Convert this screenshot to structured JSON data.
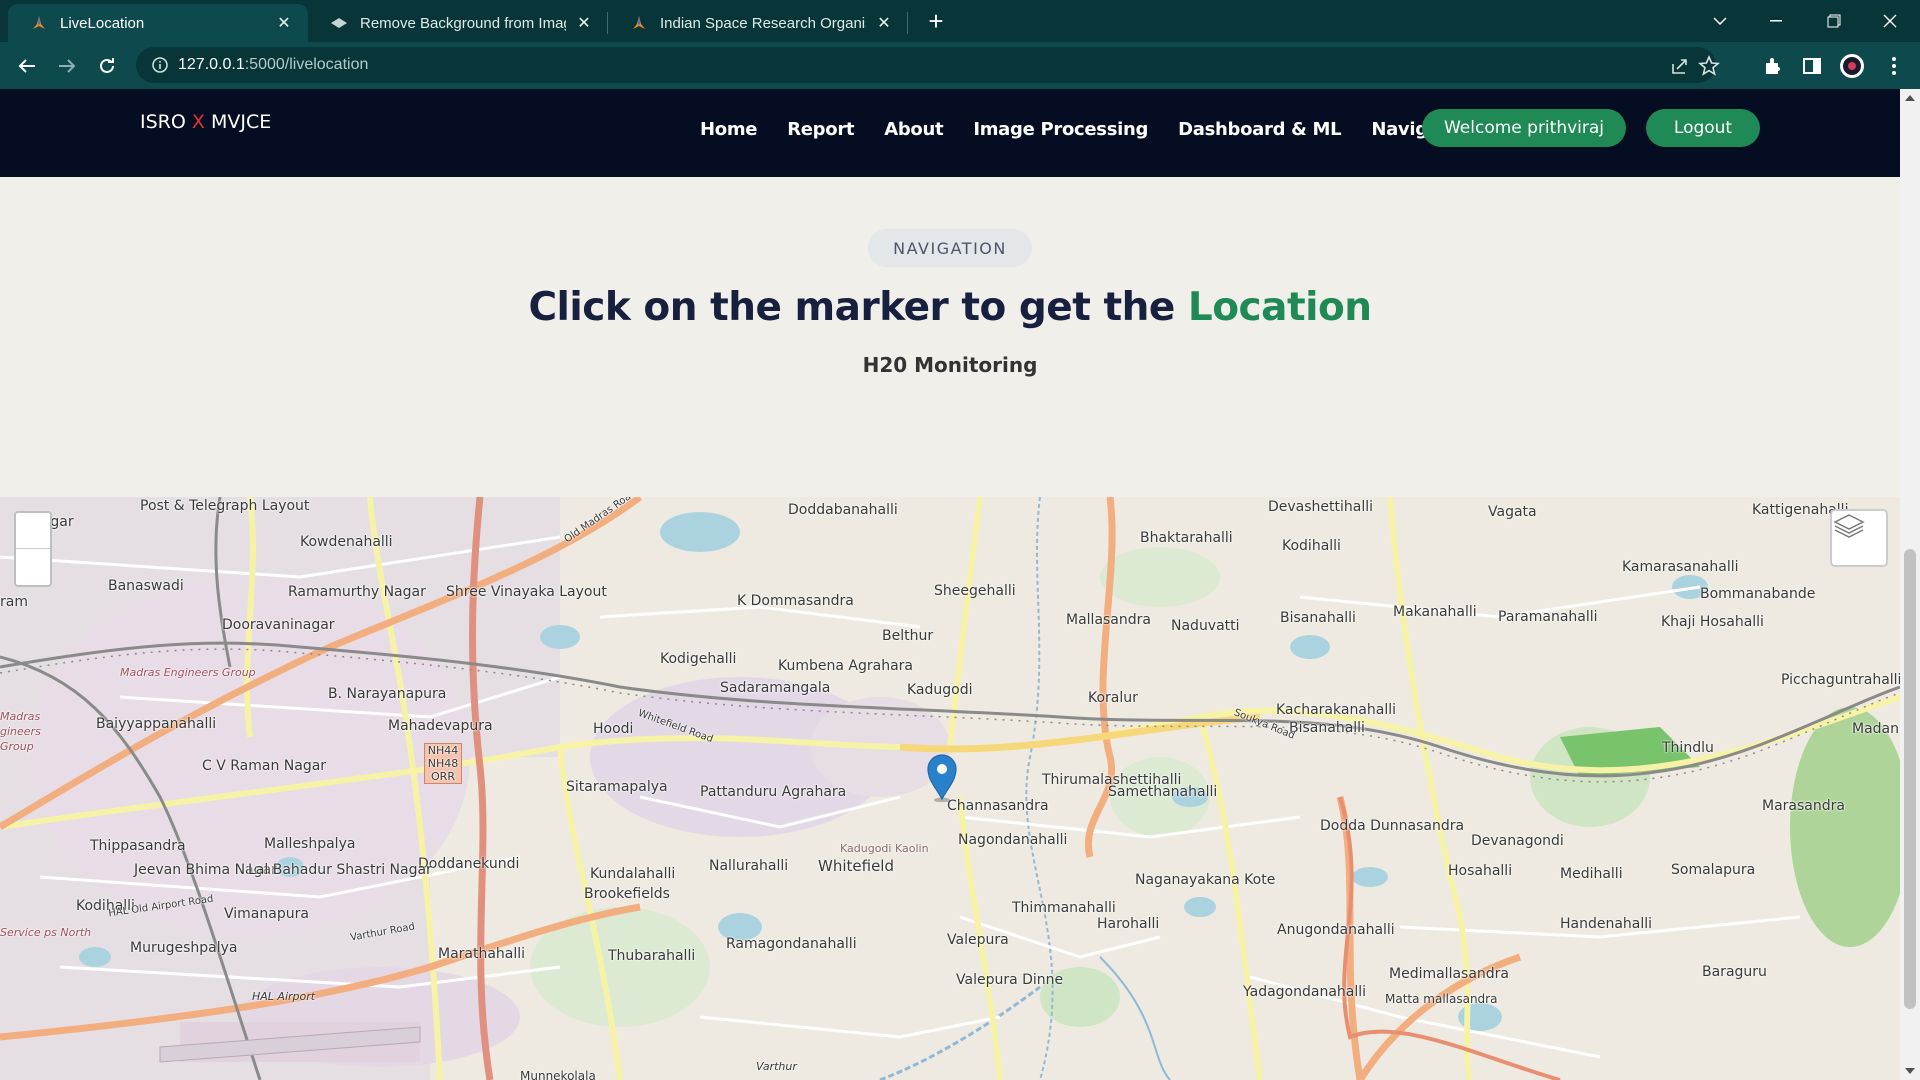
{
  "browser": {
    "tabs": [
      {
        "title": "LiveLocation",
        "active": true
      },
      {
        "title": "Remove Background from Image",
        "active": false
      },
      {
        "title": "Indian Space Research Organisati",
        "active": false
      }
    ],
    "url_host": "127.0.0.1",
    "url_path": ":5000/livelocation"
  },
  "navbar": {
    "brand_left": "ISRO ",
    "brand_x": "X",
    "brand_right": " MVJCE",
    "links": [
      "Home",
      "Report",
      "About",
      "Image Processing",
      "Dashboard & ML",
      "Navigation"
    ],
    "welcome": "Welcome prithviraj",
    "logout": "Logout"
  },
  "hero": {
    "tag": "NAVIGATION",
    "headline_plain": "Click on the marker to get the ",
    "headline_accent": "Location",
    "subhead": "H20 Monitoring"
  },
  "map": {
    "labels": [
      "Post & Telegraph Layout",
      "n Nagar",
      "Kowdenahalli",
      "Doddabanahalli",
      "Devashettihalli",
      "Vagata",
      "Kattigenahalli",
      "Bhaktarahalli",
      "Kodihalli",
      "Kamarasanahalli",
      "Bommanabande",
      "Banaswadi",
      "Ramamurthy Nagar",
      "Shree Vinayaka Layout",
      "K Dommasandra",
      "Sheegehalli",
      "ram",
      "Dooravaninagar",
      "Mallasandra",
      "Naduvatti",
      "Bisanahalli",
      "Makanahalli",
      "Paramanahalli",
      "Khaji Hosahalli",
      "Madras Engineers Group",
      "Belthur",
      "Kodigehalli",
      "Kumbena Agrahara",
      "B. Narayanapura",
      "Baiyyappanahalli",
      "Sadaramangala",
      "Kadugodi",
      "Koralur",
      "Kacharakanahalli",
      "Picchaguntrahalli",
      "Mahadevapura",
      "Hoodi",
      "Bisanahalli",
      "Madanah",
      "Thindlu",
      "C V Raman Nagar",
      "Sitaramapalya",
      "Thirumalashettihalli",
      "Samethanahalli",
      "Pattanduru Agrahara",
      "Channasandra",
      "Marasandra",
      "Dodda Dunnasandra",
      "Devanagondi",
      "Thippasandra",
      "Malleshpalya",
      "Nagondanahalli",
      "Doddanekundi",
      "Kadugodi Kaolin",
      "Nallurahalli",
      "Whitefield",
      "Jeevan Bhima Nagar",
      "Lal Bahadur Shastri Nagar",
      "Kundalahalli",
      "Brookefields",
      "Naganayakana Kote",
      "Hosahalli",
      "Medihalli",
      "Somalapura",
      "Kodihalli",
      "Vimanapura",
      "Thimmanahalli",
      "Harohalli",
      "Anugondanahalli",
      "Handenahalli",
      "Murugeshpalya",
      "Marathahalli",
      "Thubarahalli",
      "Ramagondanahalli",
      "Valepura",
      "Valepura Dinne",
      "Medimallasandra",
      "Baraguru",
      "HAL Airport",
      "Yadagondanahalli",
      "Matta mallasandra",
      "Service ps North",
      "Soukya Road",
      "Whitefield Road",
      "Old Madras Road",
      "NH44 NH48 ORR",
      "HAL Old Airport Road",
      "Varthur Road",
      "Madras gineers Group",
      "Varthur",
      "Munnekolala"
    ]
  },
  "colors": {
    "navbar_bg": "#050d22",
    "accent_green": "#1f8a55",
    "headline": "#17213f",
    "page_bg": "#f1efea",
    "marker_blue": "#2a81cb"
  },
  "icons": [
    "back-icon",
    "forward-icon",
    "reload-icon",
    "info-icon",
    "share-icon",
    "star-icon",
    "extensions-icon",
    "sidepanel-icon",
    "profile-icon",
    "menu-icon",
    "layers-icon",
    "map-marker-icon"
  ]
}
